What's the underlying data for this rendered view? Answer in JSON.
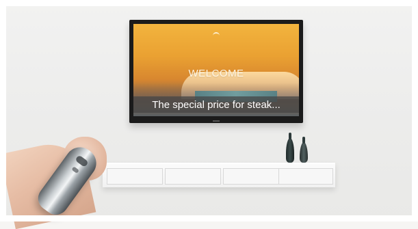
{
  "tv": {
    "welcome_text": "WELCOME",
    "caption_text": "The special price for steak..."
  },
  "colors": {
    "wall": "#ededec",
    "tv_bezel": "#1b1b1b",
    "caption_bar": "#464646",
    "screen_gold": "#eaa132"
  },
  "icons": {
    "tv_logo": "hotel-crest-icon",
    "remote": "remote-control-icon"
  }
}
